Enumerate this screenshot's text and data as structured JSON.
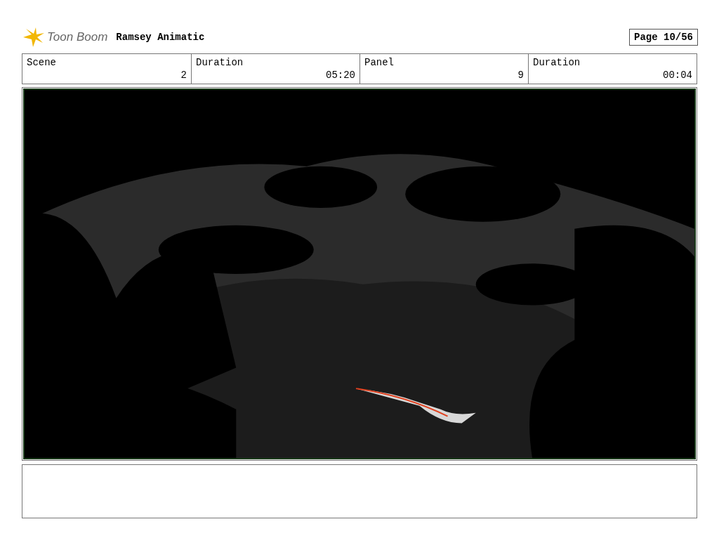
{
  "header": {
    "logo": "Toon Boom",
    "title": "Ramsey Animatic",
    "page": "Page 10/56"
  },
  "fields": [
    {
      "label": "Scene",
      "value": "2"
    },
    {
      "label": "Duration",
      "value": "05:20"
    },
    {
      "label": "Panel",
      "value": "9"
    },
    {
      "label": "Duration",
      "value": "00:04"
    }
  ]
}
